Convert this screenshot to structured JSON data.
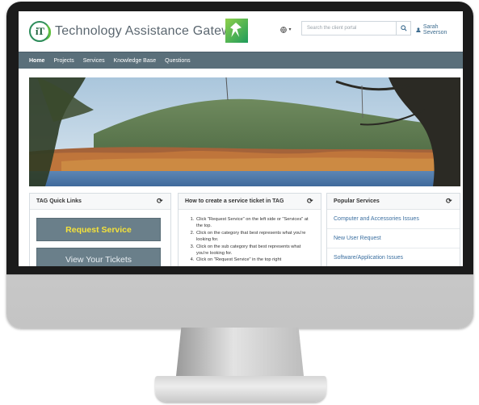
{
  "header": {
    "logo_text": "iT",
    "title": "Technology Assistance Gateway",
    "lang_icon": "globe-icon",
    "search_placeholder": "Search the client portal",
    "user_name": "Sarah Severson"
  },
  "nav": {
    "items": [
      {
        "label": "Home",
        "active": true
      },
      {
        "label": "Projects",
        "active": false
      },
      {
        "label": "Services",
        "active": false
      },
      {
        "label": "Knowledge Base",
        "active": false
      },
      {
        "label": "Questions",
        "active": false
      }
    ]
  },
  "quick_links": {
    "title": "TAG Quick Links",
    "request_service": "Request Service",
    "view_tickets": "View Your Tickets"
  },
  "how_to": {
    "title": "How to create a service ticket in TAG",
    "steps": [
      "Click \"Request Service\" on the left side or \"Services\" at the top.",
      "Click on the category that best represents what you're looking for.",
      "Click on the sub category that best represents what you're looking for.",
      "Click on \"Request Service\" in the top right"
    ]
  },
  "popular": {
    "title": "Popular Services",
    "items": [
      "Computer and Accessories Issues",
      "New User Request",
      "Software/Application Issues"
    ]
  },
  "colors": {
    "navbar": "#5a6f7a",
    "button": "#6a7f8a",
    "primary_button_text": "#f5e23a",
    "link": "#3b6fa0"
  }
}
